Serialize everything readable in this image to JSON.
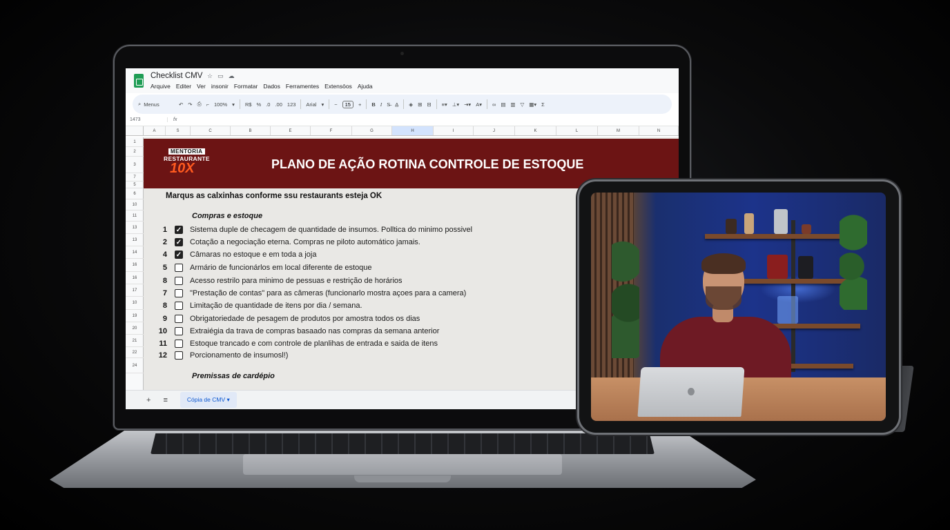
{
  "spreadsheet": {
    "doc_title": "Checklist CMV",
    "title_icons": [
      "star-icon",
      "folder-icon",
      "cloud-icon"
    ],
    "menu": [
      "Arquive",
      "Editer",
      "Ver",
      "insonir",
      "Formatar",
      "Dados",
      "Ferramentes",
      "Extensōos",
      "Ajuda"
    ],
    "toolbar": {
      "search_label": "Menus",
      "zoom": "100%",
      "currency": "R$",
      "percent": "%",
      "dec_decrease": ".0",
      "dec_increase": ".00",
      "number_format": "123",
      "font": "Arial",
      "font_size": "15",
      "bold": "B",
      "italic": "I"
    },
    "formula_bar": {
      "cell_ref": "1473",
      "fx": "fx"
    },
    "columns": [
      "A",
      "S",
      "C",
      "B",
      "E",
      "F",
      "G",
      "H",
      "I",
      "J",
      "K",
      "L",
      "M",
      "N"
    ],
    "selected_column": "H",
    "row_numbers": [
      "1",
      "2",
      "3",
      "7",
      "5",
      "6",
      "10",
      "11",
      "13",
      "13",
      "14",
      "16",
      "16",
      "17",
      "10",
      "19",
      "20",
      "21",
      "22",
      "24"
    ],
    "banner": {
      "logo_top": "MENTORIA",
      "logo_mid": "RESTAURANTE",
      "logo_big": "10X",
      "title": "PLANO DE AÇÃO ROTINA CONTROLE DE ESTOQUE",
      "background": "#6c1414"
    },
    "instruction": "Marqus as calxinhas conforme ssu restaurants esteja OK",
    "section1_title": "Compras e estoque",
    "items": [
      {
        "num": "1",
        "checked": true,
        "text": "Sistema duple de checagem de quantidade de insumos. Polltica do minimo possivel"
      },
      {
        "num": "2",
        "checked": true,
        "text": "Cotação a negociação eterna. Compras ne piloto automático jamais."
      },
      {
        "num": "4",
        "checked": true,
        "text": "Câmaras no estoque e em toda a joja"
      },
      {
        "num": "5",
        "checked": false,
        "text": "Armário de funcionárlos em local diferente de estoque"
      },
      {
        "num": "8",
        "checked": false,
        "text": "Acesso restrilo para minimo de pessuas e restrição de horários"
      },
      {
        "num": "7",
        "checked": false,
        "text": "\"Prestação de contas\" para as câmeras (funcionarlo mostra açoes para a camera)"
      },
      {
        "num": "8",
        "checked": false,
        "text": "Limitação de quantidade de itens por dia / semana."
      },
      {
        "num": "9",
        "checked": false,
        "text": "Obrigatoriedade de pesagem de produtos por amostra todos os dias"
      },
      {
        "num": "10",
        "checked": false,
        "text": "Extraiégia da trava de compras basaado nas compras da semana anterior"
      },
      {
        "num": "11",
        "checked": false,
        "text": "Estoque trancado e com controle de planlihas de entrada e saida de itens"
      },
      {
        "num": "12",
        "checked": false,
        "text": "Porcionamento de insumosl!)"
      }
    ],
    "section2_title": "Premissas de cardépio",
    "tabbar": {
      "add": "+",
      "list": "≡",
      "sheet_tab": "Cópia de CMV",
      "sheet_tab_arrow": "▾"
    }
  },
  "colors": {
    "checkbox_checked": "#222222",
    "banner_title": "#ffffff",
    "logo_accent": "#ff5a1f"
  }
}
